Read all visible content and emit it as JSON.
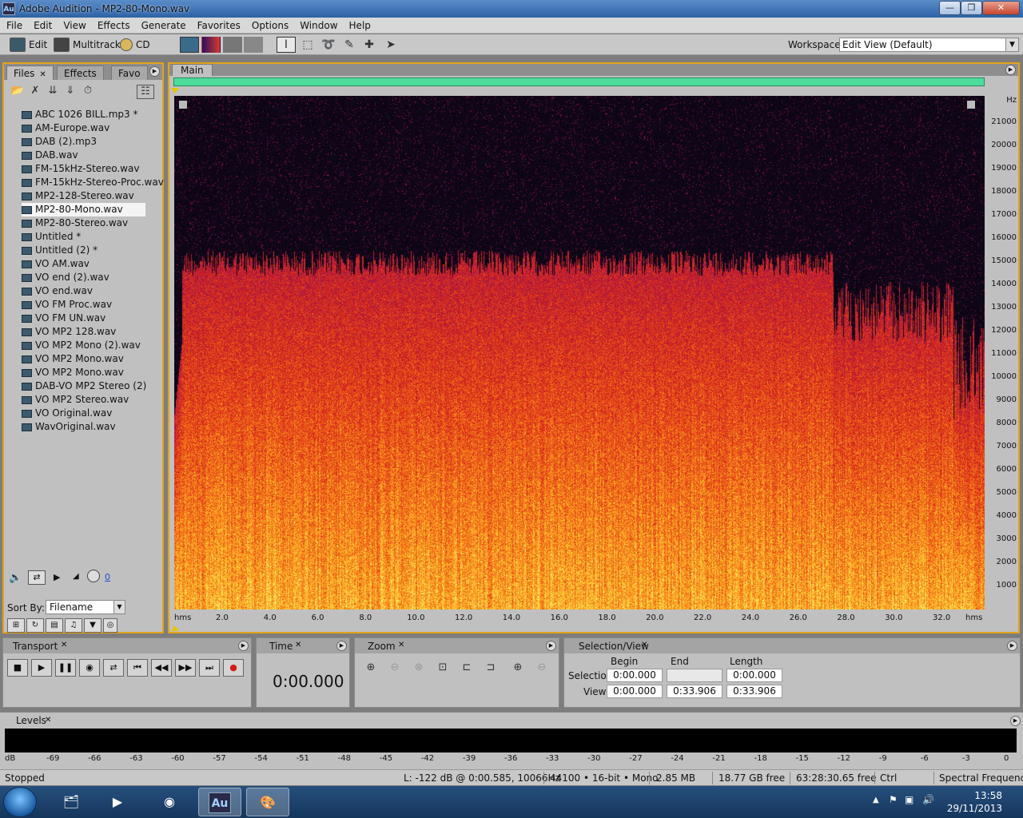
{
  "window": {
    "app_icon_text": "Au",
    "title": "Adobe Audition - MP2-80-Mono.wav",
    "minimize": "—",
    "maximize": "❐",
    "close": "✕"
  },
  "menu": [
    "File",
    "Edit",
    "View",
    "Effects",
    "Generate",
    "Favorites",
    "Options",
    "Window",
    "Help"
  ],
  "toolbar": {
    "edit_label": "Edit",
    "multitrack_label": "Multitrack",
    "cd_label": "CD",
    "workspace_label": "Workspace:",
    "workspace_value": "Edit View (Default)"
  },
  "files_panel": {
    "tabs": [
      "Files",
      "Effects",
      "Favo"
    ],
    "files": [
      "ABC 1026 BILL.mp3 *",
      "AM-Europe.wav",
      "DAB (2).mp3",
      "DAB.wav",
      "FM-15kHz-Stereo.wav",
      "FM-15kHz-Stereo-Proc.wav",
      "MP2-128-Stereo.wav",
      "MP2-80-Mono.wav",
      "MP2-80-Stereo.wav",
      "Untitled *",
      "Untitled (2) *",
      "VO AM.wav",
      "VO end (2).wav",
      "VO end.wav",
      "VO FM Proc.wav",
      "VO FM UN.wav",
      "VO MP2 128.wav",
      "VO MP2 Mono (2).wav",
      "VO MP2 Mono.wav",
      "VO MP2 Mono.wav",
      "DAB-VO MP2 Stereo (2)",
      "VO MP2 Stereo.wav",
      "VO Original.wav",
      "WavOriginal.wav"
    ],
    "selected_file": "MP2-80-Mono.wav",
    "volume_value": "0",
    "sort_by_label": "Sort By:",
    "sort_by_value": "Filename"
  },
  "main_panel": {
    "tab": "Main",
    "freq_unit": "Hz",
    "freq_labels": [
      "21000",
      "20000",
      "19000",
      "18000",
      "17000",
      "16000",
      "15000",
      "14000",
      "13000",
      "12000",
      "11000",
      "10000",
      "9000",
      "8000",
      "7000",
      "6000",
      "5000",
      "4000",
      "3000",
      "2000",
      "1000"
    ],
    "time_unit": "hms",
    "time_labels": [
      "2.0",
      "4.0",
      "6.0",
      "8.0",
      "10.0",
      "12.0",
      "14.0",
      "16.0",
      "18.0",
      "20.0",
      "22.0",
      "24.0",
      "26.0",
      "28.0",
      "30.0",
      "32.0"
    ]
  },
  "transport": {
    "title": "Transport"
  },
  "time_panel": {
    "title": "Time",
    "value": "0:00.000"
  },
  "zoom_panel": {
    "title": "Zoom"
  },
  "selection_view": {
    "title": "Selection/View",
    "col_begin": "Begin",
    "col_end": "End",
    "col_length": "Length",
    "row_selection": "Selection",
    "row_view": "View",
    "sel_begin": "0:00.000",
    "sel_end": "",
    "sel_length": "0:00.000",
    "view_begin": "0:00.000",
    "view_end": "0:33.906",
    "view_length": "0:33.906"
  },
  "levels": {
    "title": "Levels",
    "scale": [
      "dB",
      "-69",
      "-66",
      "-63",
      "-60",
      "-57",
      "-54",
      "-51",
      "-48",
      "-45",
      "-42",
      "-39",
      "-36",
      "-33",
      "-30",
      "-27",
      "-24",
      "-21",
      "-18",
      "-15",
      "-12",
      "-9",
      "-6",
      "-3",
      "0"
    ]
  },
  "status": {
    "state": "Stopped",
    "cursor": "L: -122 dB @   0:00.585, 10066Hz",
    "format": "44100 • 16-bit • Mono",
    "size": "2.85 MB",
    "disk_free": "18.77 GB free",
    "time_free": "63:28:30.65 free",
    "modifier": "Ctrl",
    "view_mode": "Spectral Frequency"
  },
  "taskbar": {
    "active_app": "Au",
    "clock_time": "13:58",
    "clock_date": "29/11/2013"
  }
}
